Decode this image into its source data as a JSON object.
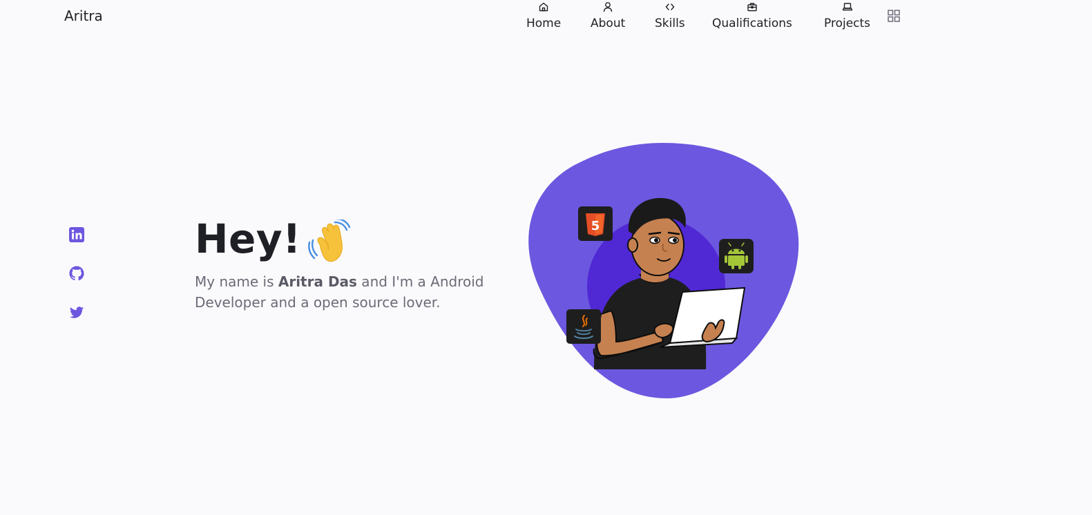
{
  "header": {
    "brand": "Aritra",
    "nav": [
      {
        "label": "Home",
        "icon": "home-icon"
      },
      {
        "label": "About",
        "icon": "user-icon"
      },
      {
        "label": "Skills",
        "icon": "code-icon"
      },
      {
        "label": "Qualifications",
        "icon": "briefcase-icon"
      },
      {
        "label": "Projects",
        "icon": "laptop-icon"
      }
    ],
    "menu_icon": "grid-icon"
  },
  "social": [
    {
      "name": "linkedin",
      "icon": "linkedin-icon"
    },
    {
      "name": "github",
      "icon": "github-icon"
    },
    {
      "name": "twitter",
      "icon": "twitter-icon"
    }
  ],
  "hero": {
    "title": "Hey!",
    "wave_icon": "waving-hand-icon",
    "desc_prefix": "My name is ",
    "desc_name": "Aritra Das",
    "desc_suffix": " and I'm a Android Developer and a open source lover."
  },
  "illustration": {
    "badges": [
      "html5-icon",
      "android-icon",
      "java-icon"
    ]
  },
  "colors": {
    "accent": "#6c57e0",
    "accent_dark": "#4f2fd4",
    "background": "#fafafc",
    "text": "#1f1f26",
    "muted": "#6b6b78"
  }
}
